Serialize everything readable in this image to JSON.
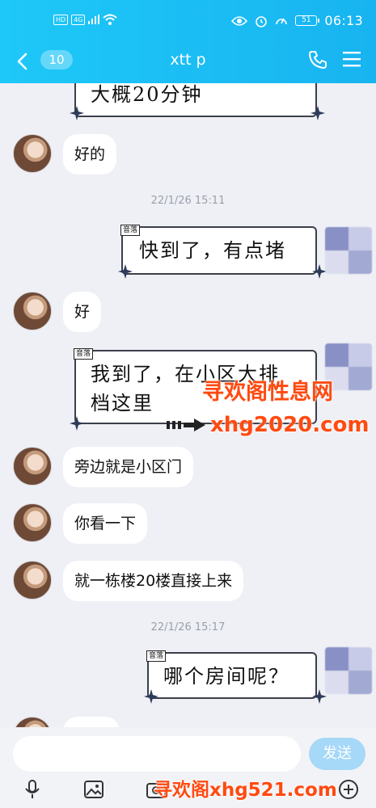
{
  "status_bar": {
    "left_badges": [
      "HD",
      "4G"
    ],
    "battery": "51",
    "time": "06:13"
  },
  "nav": {
    "unread_count": "10",
    "title": "xtt p"
  },
  "messages": {
    "card_top_text": "大概20分钟",
    "m1": "好的",
    "ts1": "22/1/26 15:11",
    "card1_tag": "音落",
    "card1_text": "快到了，有点堵",
    "m2": "好",
    "card2_tag": "音落",
    "card2_line1": "我到了，在小区大排",
    "card2_line2": "档这里",
    "m3": "旁边就是小区门",
    "m4": "你看一下",
    "m5": "就一栋楼20楼直接上来",
    "ts2": "22/1/26 15:17",
    "card3_tag": "音落",
    "card3_text": "哪个房间呢？"
  },
  "watermarks": {
    "w1": "寻欢阁性息网",
    "w2": "xhg2020.com",
    "w3": "寻欢阁xhg521.com"
  },
  "footer": {
    "send_label": "发送"
  },
  "colors": {
    "header": "#1ec8f8",
    "send": "#a6d8f7",
    "watermark": "#ff4a10"
  }
}
